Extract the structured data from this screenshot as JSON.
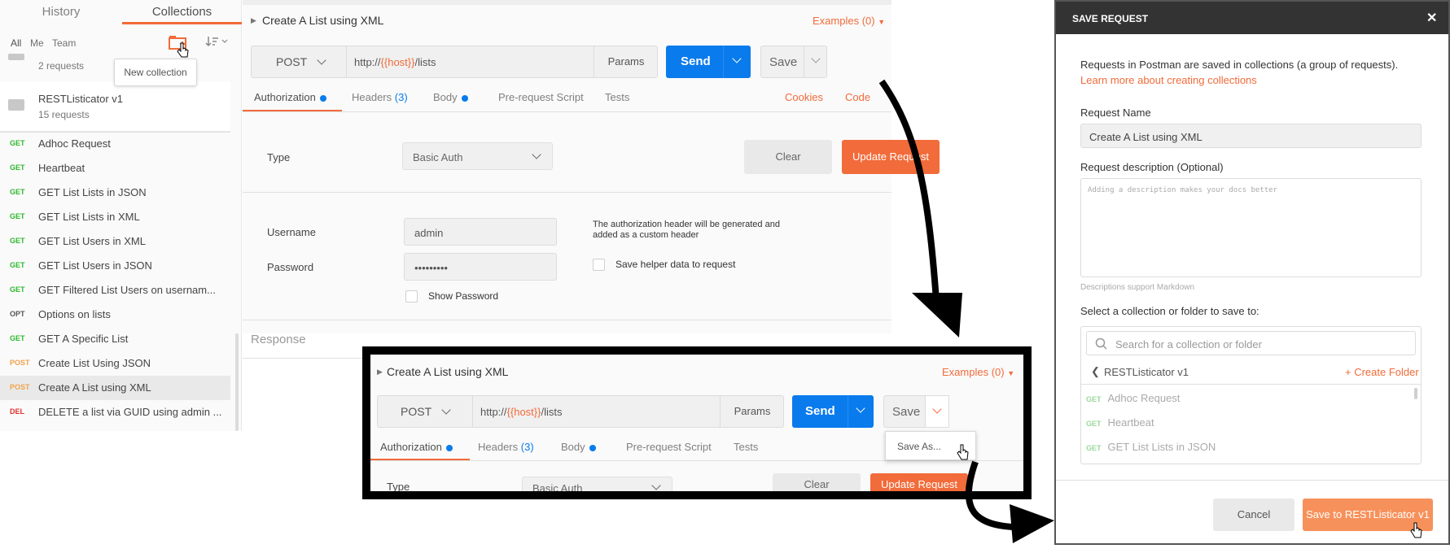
{
  "sidebar": {
    "tabs": [
      "History",
      "Collections"
    ],
    "filters": [
      "All",
      "Me",
      "Team"
    ],
    "tooltip": "New collection",
    "collection_above_count": "2 requests",
    "collection": {
      "name": "RESTListicator v1",
      "count": "15 requests"
    },
    "requests": [
      {
        "method": "GET",
        "name": "Adhoc Request"
      },
      {
        "method": "GET",
        "name": "Heartbeat"
      },
      {
        "method": "GET",
        "name": "GET List Lists in JSON"
      },
      {
        "method": "GET",
        "name": "GET List Lists in XML"
      },
      {
        "method": "GET",
        "name": "GET List Users in XML"
      },
      {
        "method": "GET",
        "name": "GET List Users in JSON"
      },
      {
        "method": "GET",
        "name": "GET Filtered List Users on usernam..."
      },
      {
        "method": "OPT",
        "name": "Options on lists"
      },
      {
        "method": "GET",
        "name": "GET A Specific List"
      },
      {
        "method": "POST",
        "name": "Create List Using JSON"
      },
      {
        "method": "POST",
        "name": "Create A List using XML"
      },
      {
        "method": "DEL",
        "name": "DELETE a list via GUID using admin ..."
      }
    ]
  },
  "request": {
    "title": "Create A List using XML",
    "examples": "Examples (0)",
    "method": "POST",
    "url_prefix": "http://",
    "url_var": "{{host}}",
    "url_suffix": "/lists",
    "params": "Params",
    "send": "Send",
    "save": "Save",
    "tabs": {
      "authorization": "Authorization",
      "headers": "Headers",
      "headers_count": "(3)",
      "body": "Body",
      "prerequest": "Pre-request Script",
      "tests": "Tests"
    },
    "cookies": "Cookies",
    "code": "Code",
    "type_label": "Type",
    "auth_type": "Basic Auth",
    "clear": "Clear",
    "update": "Update Request",
    "username_label": "Username",
    "username_value": "admin",
    "password_label": "Password",
    "password_value": "•••••••••",
    "auth_note": "The authorization header will be generated and added as a custom header",
    "save_helper": "Save helper data to request",
    "show_password": "Show Password",
    "response": "Response",
    "save_as": "Save As..."
  },
  "dialog": {
    "title": "SAVE REQUEST",
    "intro": "Requests in Postman are saved in collections (a group of requests).",
    "learn_more": "Learn more about creating collections",
    "name_label": "Request Name",
    "name_value": "Create A List using XML",
    "desc_label": "Request description (Optional)",
    "desc_placeholder": "Adding a description makes your docs better",
    "markdown_hint": "Descriptions support Markdown",
    "select_label": "Select a collection or folder to save to:",
    "search_placeholder": "Search for a collection or folder",
    "current_collection": "RESTListicator v1",
    "create_folder": "+ Create Folder",
    "items": [
      {
        "method": "GET",
        "name": "Adhoc Request"
      },
      {
        "method": "GET",
        "name": "Heartbeat"
      },
      {
        "method": "GET",
        "name": "GET List Lists in JSON"
      }
    ],
    "cancel": "Cancel",
    "save_to": "Save to RESTListicator v1"
  },
  "colors": {
    "accent": "#f26b3a",
    "send_blue": "#097bed",
    "get": "#2eb82e",
    "post": "#f0a24b",
    "delete": "#e0322e"
  }
}
